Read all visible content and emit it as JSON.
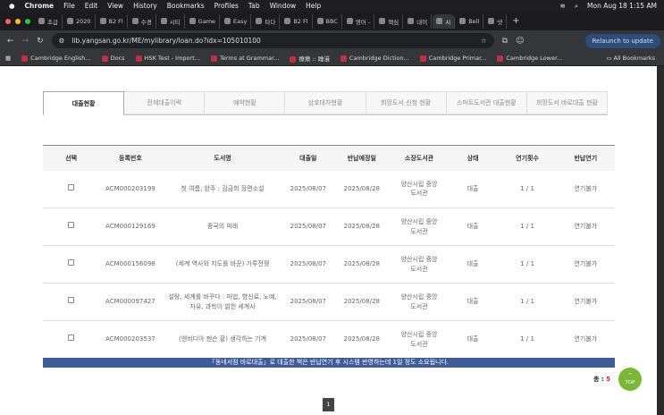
{
  "menubar": {
    "app": "Chrome",
    "items": [
      "File",
      "Edit",
      "View",
      "History",
      "Bookmarks",
      "Profiles",
      "Tab",
      "Window",
      "Help"
    ],
    "clock": "Mon Aug 18  1:15 AM"
  },
  "tabs": [
    "초급",
    "2020",
    "B2 Fl",
    "수경",
    "시티",
    "Game",
    "Easy",
    "타다",
    "B2 Fl",
    "BBC",
    "영어 -",
    "핵심",
    "내이",
    "시",
    "Bell",
    "넷"
  ],
  "address": {
    "url": "lib.yangsan.go.kr/ME/mylibrary/loan.do?idx=105010100",
    "relaunch": "Relaunch to update"
  },
  "bookmarks": [
    "Cambridge English...",
    "Docs",
    "HSK Test - Import...",
    "Terms at Grammar...",
    "療療 :: 睡漫",
    "Cambridge Diction...",
    "Cambridge Primar...",
    "Cambridge Lower..."
  ],
  "all_bookmarks": "All Bookmarks",
  "page_tabs": [
    "대출현황",
    "전체대출이력",
    "예약현황",
    "상호대차현황",
    "희망도서 신청 현황",
    "스마트도서관 대출현황",
    "희망도서 바로대출 현황"
  ],
  "table": {
    "headers": [
      "선택",
      "등록번호",
      "도서명",
      "대출일",
      "반납예정일",
      "소장도서관",
      "상태",
      "연기횟수",
      "반납연기"
    ],
    "rows": [
      [
        "ACM000203199",
        "첫 여름, 완주 : 김금희 장편소설",
        "2025/08/07",
        "2025/08/28",
        "양산시립 중앙도서관",
        "대출",
        "1 / 1",
        "연기불가"
      ],
      [
        "ACM000129169",
        "중국의 미래",
        "2025/08/07",
        "2025/08/28",
        "양산시립 중앙도서관",
        "대출",
        "1 / 1",
        "연기불가"
      ],
      [
        "ACM000156098",
        "(세계 역사와 지도를 바꾼) 가루전쟁",
        "2025/08/07",
        "2025/08/28",
        "양산시립 중앙도서관",
        "대출",
        "1 / 1",
        "연기불가"
      ],
      [
        "ACM000097427",
        "설탕, 세계를 바꾸다 : 마법, 향신료, 노예, 자유, 과학이 얽힌 세계사",
        "2025/08/07",
        "2025/08/28",
        "양산시립 중앙도서관",
        "대출",
        "1 / 1",
        "연기불가"
      ],
      [
        "ACM000203537",
        "(엔비디아 젠슨 황) 생각하는 기계",
        "2025/08/07",
        "2025/08/28",
        "양산시립 중앙도서관",
        "대출",
        "1 / 1",
        "연기불가"
      ]
    ]
  },
  "notice": "「동네서점 바로대출」로 대출한 책은 반납연기 후 시스템 반영하는데 1일 정도 소요됩니다.",
  "total_label": "총 : ",
  "total_count": "5",
  "top_button": {
    "arrow": "^",
    "label": "TOP"
  },
  "pagination": {
    "current": "1"
  }
}
